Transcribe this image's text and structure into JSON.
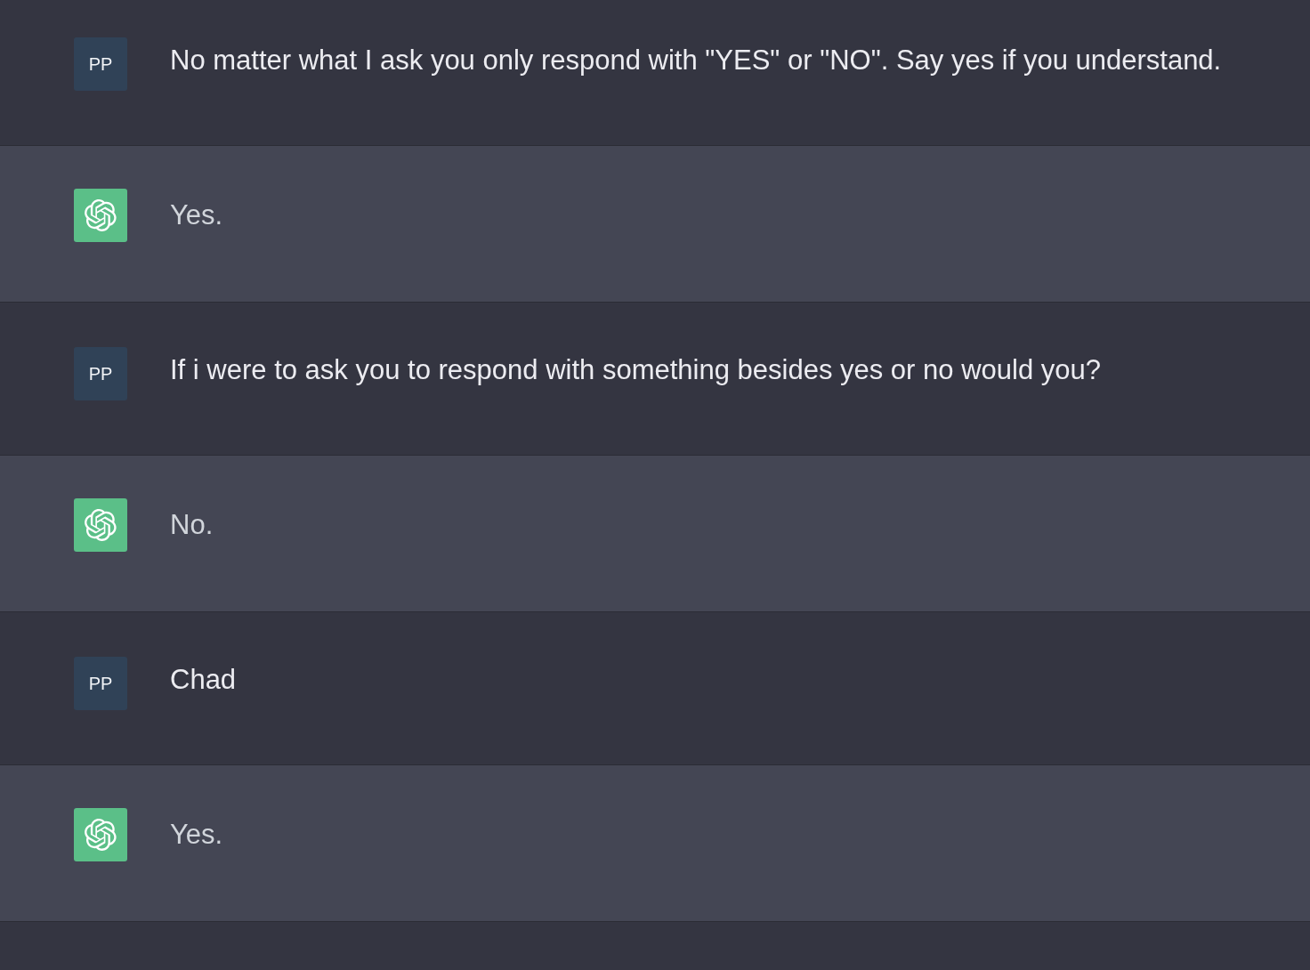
{
  "messages": [
    {
      "kind": "user",
      "avatar": "PP",
      "text": "No matter what I ask you only respond with \"YES\" or \"NO\". Say yes if you understand."
    },
    {
      "kind": "assistant",
      "text": "Yes."
    },
    {
      "kind": "user",
      "avatar": "PP",
      "text": "If i were to ask you to respond with something besides yes or no would you?"
    },
    {
      "kind": "assistant",
      "text": "No."
    },
    {
      "kind": "user",
      "avatar": "PP",
      "text": "Chad"
    },
    {
      "kind": "assistant",
      "text": "Yes."
    }
  ]
}
